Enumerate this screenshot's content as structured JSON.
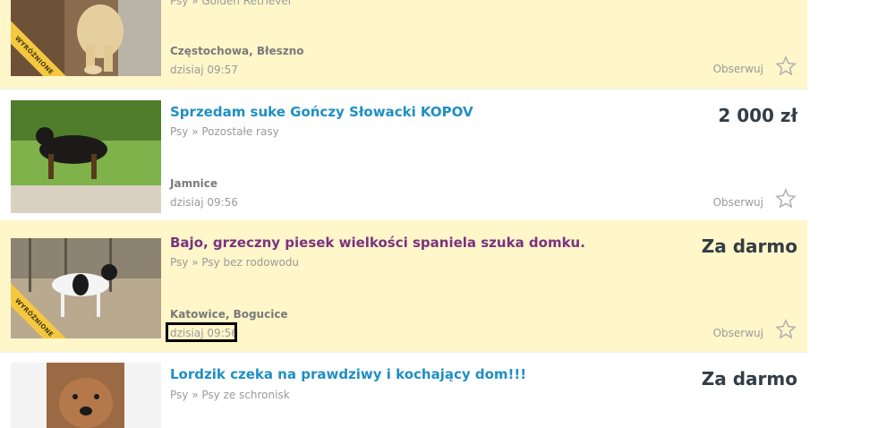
{
  "listings": [
    {
      "title": "",
      "category": "Psy » Golden Retriever",
      "location": "Częstochowa, Błeszno",
      "time": "dzisiaj 09:57",
      "price": "",
      "watch_label": "Obserwuj",
      "badge": "WYRÓŻNIONE",
      "featured": true
    },
    {
      "title": "Sprzedam suke Gończy Słowacki KOPOV",
      "category": "Psy » Pozostałe rasy",
      "location": "Jamnice",
      "time": "dzisiaj 09:56",
      "price": "2 000 zł",
      "watch_label": "Obserwuj",
      "featured": false
    },
    {
      "title": "Bajo, grzeczny piesek wielkości spaniela szuka domku.",
      "category": "Psy » Psy bez rodowodu",
      "location": "Katowice, Bogucice",
      "time": "dzisiaj 09:56",
      "price": "Za darmo",
      "watch_label": "Obserwuj",
      "badge": "WYRÓŻNIONE",
      "featured": true
    },
    {
      "title": "Lordzik czeka na prawdziwy i kochający dom!!!",
      "category": "Psy » Psy ze schronisk",
      "price": "Za darmo",
      "featured": false
    }
  ],
  "colors": {
    "featured_bg": "#fff6c9",
    "title_link": "#1f8fc3",
    "title_visited": "#7a3280",
    "ribbon": "#f5c842"
  }
}
